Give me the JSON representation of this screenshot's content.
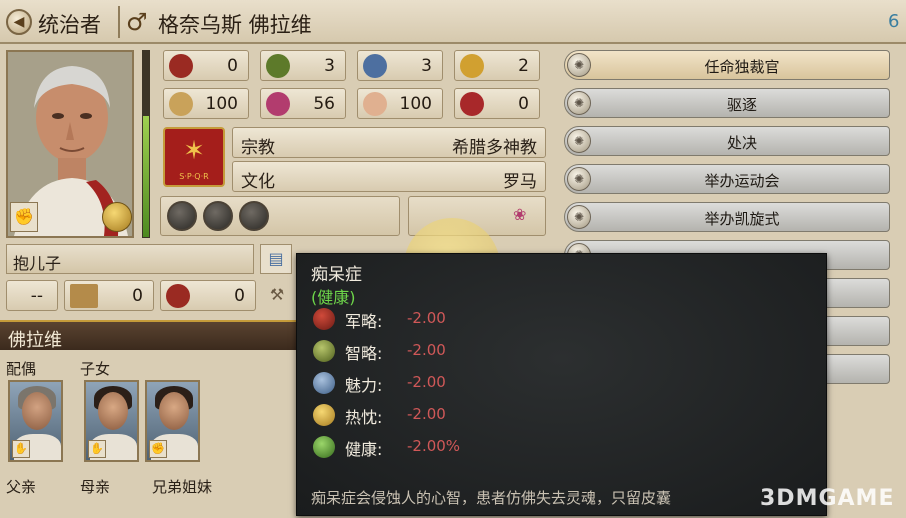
{
  "header": {
    "back_label": "统治者",
    "gender_symbol": "♂",
    "character_name": "格奈乌斯 佛拉维",
    "corner_value": "6"
  },
  "stats": [
    {
      "icon": "helmet-icon",
      "value": "0",
      "color": "#9a2a22"
    },
    {
      "icon": "laurel-icon",
      "value": "3",
      "color": "#5d7a2a"
    },
    {
      "icon": "scroll-icon",
      "value": "3",
      "color": "#4d6fa0"
    },
    {
      "icon": "sun-icon",
      "value": "2",
      "color": "#d1a030"
    },
    {
      "icon": "horseshoe-icon",
      "value": "100",
      "color": "#c9a25a"
    },
    {
      "icon": "rose-icon",
      "value": "56",
      "color": "#b23c6e"
    },
    {
      "icon": "hand-icon",
      "value": "100",
      "color": "#e0b090"
    },
    {
      "icon": "dagger-icon",
      "value": "0",
      "color": "#a8282a"
    }
  ],
  "emblem": {
    "mark": "✶",
    "text": "S·P·Q·R",
    "color": "#a41e1b"
  },
  "info": [
    {
      "label": "宗教",
      "value": "希腊多神教"
    },
    {
      "label": "文化",
      "value": "罗马"
    }
  ],
  "adopt_label": "抱儿子",
  "counters": [
    {
      "icon": "",
      "value": "--"
    },
    {
      "icon": "aqueduct-icon",
      "value": "0"
    },
    {
      "icon": "chariot-icon",
      "value": "0"
    }
  ],
  "family": {
    "section_title": "佛拉维",
    "spouse_label": "配偶",
    "children_label": "子女",
    "father_label": "父亲",
    "mother_label": "母亲",
    "siblings_label": "兄弟姐妹"
  },
  "actions": [
    {
      "label": "任命独裁官"
    },
    {
      "label": "驱逐"
    },
    {
      "label": "处决"
    },
    {
      "label": "举办运动会"
    },
    {
      "label": "举办凯旋式"
    }
  ],
  "tooltip": {
    "title": "痴呆症",
    "subtitle": "(健康)",
    "rows": [
      {
        "icon": "helmet-icon",
        "name": "军略:",
        "mod": "-2.00"
      },
      {
        "icon": "laurel-icon",
        "name": "智略:",
        "mod": "-2.00"
      },
      {
        "icon": "scroll-icon",
        "name": "魅力:",
        "mod": "-2.00"
      },
      {
        "icon": "sun-icon",
        "name": "热忱:",
        "mod": "-2.00"
      },
      {
        "icon": "laurel-heart-icon",
        "name": "健康:",
        "mod": "-2.00%"
      }
    ],
    "description": "痴呆症会侵蚀人的心智，患者仿佛失去灵魂，只留皮囊"
  },
  "watermark": "3DMGAME"
}
